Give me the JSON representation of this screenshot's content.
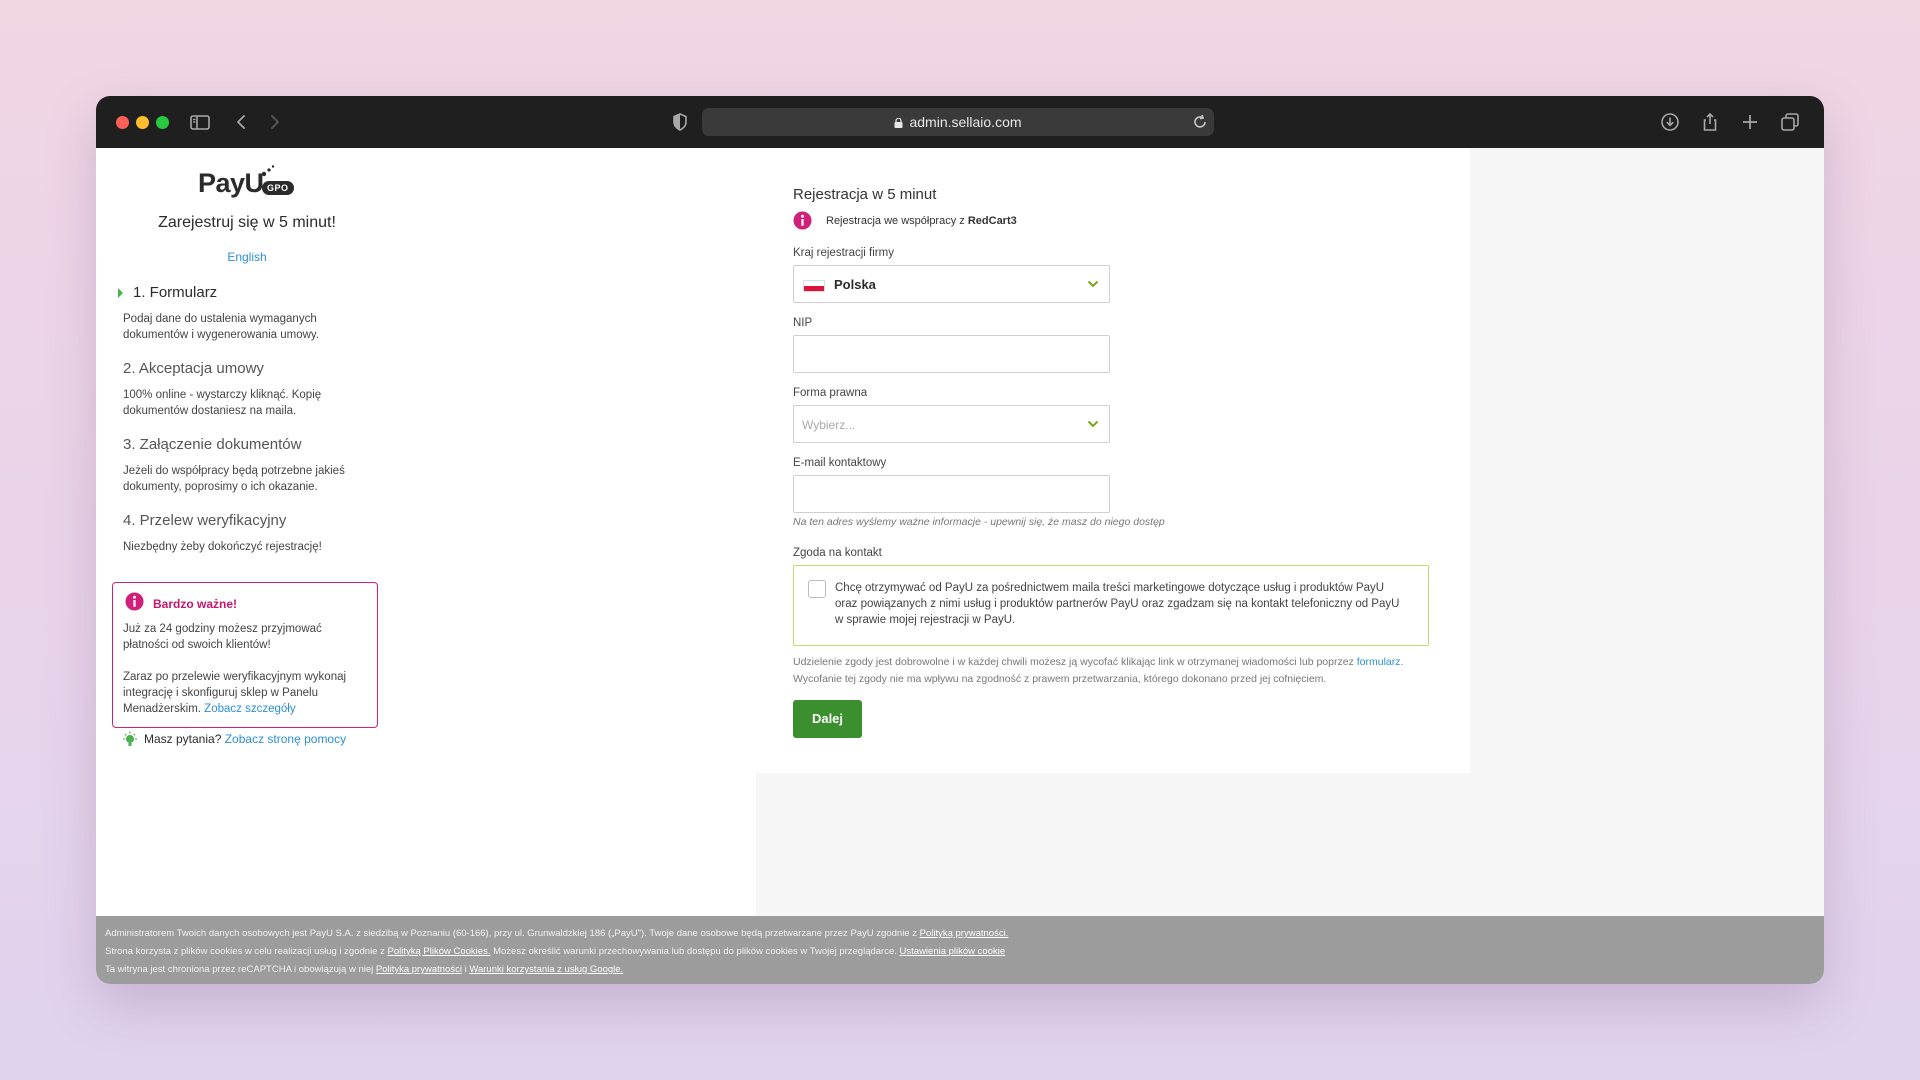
{
  "browser": {
    "url": "admin.sellaio.com"
  },
  "sidebar": {
    "logo_text": "PayU",
    "logo_badge": "GPO",
    "title": "Zarejestruj się w 5 minut!",
    "language_link": "English",
    "steps": [
      {
        "title": "1. Formularz",
        "desc": "Podaj dane do ustalenia wymaganych dokumentów i wygenerowania umowy.",
        "active": true
      },
      {
        "title": "2. Akceptacja umowy",
        "desc": "100% online - wystarczy kliknąć. Kopię dokumentów dostaniesz na maila.",
        "active": false
      },
      {
        "title": "3. Załączenie dokumentów",
        "desc": "Jeżeli do współpracy będą potrzebne jakieś dokumenty, poprosimy o ich okazanie.",
        "active": false
      },
      {
        "title": "4. Przelew weryfikacyjny",
        "desc": "Niezbędny żeby dokończyć rejestrację!",
        "active": false
      }
    ],
    "important": {
      "heading": "Bardzo ważne!",
      "para1": "Już za 24 godziny możesz przyjmować płatności od swoich klientów!",
      "para2": "Zaraz po przelewie weryfikacyjnym wykonaj integrację i skonfiguruj sklep w Panelu Menadżerskim.",
      "link": "Zobacz szczegóły"
    },
    "help": {
      "text": "Masz pytania?",
      "link": "Zobacz stronę pomocy"
    }
  },
  "form": {
    "title": "Rejestracja w 5 minut",
    "info_prefix": "Rejestracja we współpracy z",
    "info_partner": "RedCart3",
    "country_label": "Kraj rejestracji firmy",
    "country_value": "Polska",
    "nip_label": "NIP",
    "nip_value": "",
    "legal_form_label": "Forma prawna",
    "legal_form_placeholder": "Wybierz...",
    "email_label": "E-mail kontaktowy",
    "email_value": "",
    "email_hint": "Na ten adres wyślemy ważne informacje - upewnij się, że masz do niego dostęp",
    "consent_label": "Zgoda na kontakt",
    "consent_checked": false,
    "consent_text": "Chcę otrzymywać od PayU za pośrednictwem maila treści marketingowe dotyczące usług i produktów PayU oraz powiązanych z nimi usług i produktów partnerów PayU oraz zgadzam się na kontakt telefoniczny od PayU w sprawie mojej rejestracji w PayU.",
    "disclaimer_prefix": "Udzielenie zgody jest dobrowolne i w każdej chwili możesz ją wycofać klikając link w otrzymanej wiadomości lub poprzez",
    "disclaimer_link": "formularz",
    "disclaimer_suffix": ". Wycofanie tej zgody nie ma wpływu na zgodność z prawem przetwarzania, którego dokonano przed jej cofnięciem.",
    "submit_label": "Dalej"
  },
  "footer": {
    "line1_text": "Administratorem Twoich danych osobowych jest PayU S.A. z siedzibą w Poznaniu (60-166), przy ul. Grunwaldzkiej 186 („PayU\"). Twoje dane osobowe będą przetwarzane przez PayU zgodnie z",
    "line1_link": "Polityką prywatności.",
    "line2_text1": "Strona korzysta z plików cookies w celu realizacji usług i zgodnie z",
    "line2_link1": "Polityką Plików Cookies.",
    "line2_text2": "Możesz określić warunki przechowywania lub dostępu do plików cookies w Twojej przeglądarce.",
    "line2_link2": "Ustawienia plików cookie",
    "line3_text": "Ta witryna jest chroniona przez reCAPTCHA i obowiązują w niej",
    "line3_link1": "Polityka prywatności",
    "line3_sep": "i",
    "line3_link2": "Warunki korzystania z usług Google."
  },
  "colors": {
    "accent_pink": "#d0207a",
    "button_green": "#3c8f2e",
    "link_blue": "#2b8fd6",
    "consent_border": "#c9d96b"
  },
  "icons": [
    "sidebar-toggle-icon",
    "back-icon",
    "forward-icon",
    "shield-icon",
    "lock-icon",
    "reload-icon",
    "download-icon",
    "share-icon",
    "new-tab-icon",
    "tabs-overview-icon",
    "info-icon",
    "lightbulb-icon",
    "chevron-down-icon",
    "poland-flag-icon"
  ]
}
